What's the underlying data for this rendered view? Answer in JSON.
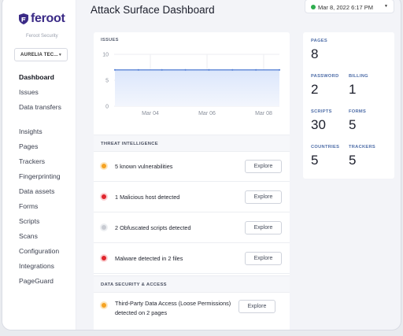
{
  "brand": {
    "name": "feroot",
    "subtitle": "Feroot Security",
    "color": "#3a2a86"
  },
  "org_selector": {
    "value": "AURELIA TEC..."
  },
  "sidebar": {
    "items": [
      {
        "label": "Dashboard",
        "active": true
      },
      {
        "label": "Issues"
      },
      {
        "label": "Data transfers"
      },
      {
        "label": "Insights"
      },
      {
        "label": "Pages"
      },
      {
        "label": "Trackers"
      },
      {
        "label": "Fingerprinting"
      },
      {
        "label": "Data assets"
      },
      {
        "label": "Forms"
      },
      {
        "label": "Scripts"
      },
      {
        "label": "Scans"
      },
      {
        "label": "Configuration"
      },
      {
        "label": "Integrations"
      },
      {
        "label": "PageGuard"
      }
    ]
  },
  "header": {
    "title": "Attack Surface Dashboard",
    "date": "Mar 8, 2022 6:17 PM",
    "status_color": "#2eae4e"
  },
  "issues": {
    "label": "ISSUES",
    "chart_data": {
      "type": "area",
      "y_ticks": [
        "10",
        "5",
        "0"
      ],
      "ylim": [
        0,
        10
      ],
      "x_ticks": [
        "Mar 04",
        "Mar 06",
        "Mar 08"
      ],
      "values": [
        7,
        7,
        7,
        7,
        7,
        7,
        7,
        7
      ],
      "line_color": "#5b84d6",
      "fill_color": "#dbe6fb"
    }
  },
  "threat_intelligence": {
    "heading": "THREAT INTELLIGENCE",
    "rows": [
      {
        "text": "5 known vulnerabilities",
        "severity": "orange",
        "button": "Explore"
      },
      {
        "text": "1 Malicious host detected",
        "severity": "red",
        "button": "Explore"
      },
      {
        "text": "2 Obfuscated scripts detected",
        "severity": "gray",
        "button": "Explore"
      },
      {
        "text": "Malware detected in 2 files",
        "severity": "red",
        "button": "Explore"
      }
    ]
  },
  "data_security": {
    "heading": "DATA SECURITY & ACCESS",
    "rows": [
      {
        "text": "Third-Party Data Access (Loose Permissions) detected on 2 pages",
        "severity": "orange",
        "button": "Explore"
      }
    ]
  },
  "stats": {
    "pages": {
      "label": "PAGES",
      "value": "8"
    },
    "password": {
      "label": "PASSWORD",
      "value": "2"
    },
    "billing": {
      "label": "BILLING",
      "value": "1"
    },
    "scripts": {
      "label": "SCRIPTS",
      "value": "30"
    },
    "forms": {
      "label": "FORMS",
      "value": "5"
    },
    "countries": {
      "label": "COUNTRIES",
      "value": "5"
    },
    "trackers": {
      "label": "TRACKERS",
      "value": "5"
    }
  }
}
